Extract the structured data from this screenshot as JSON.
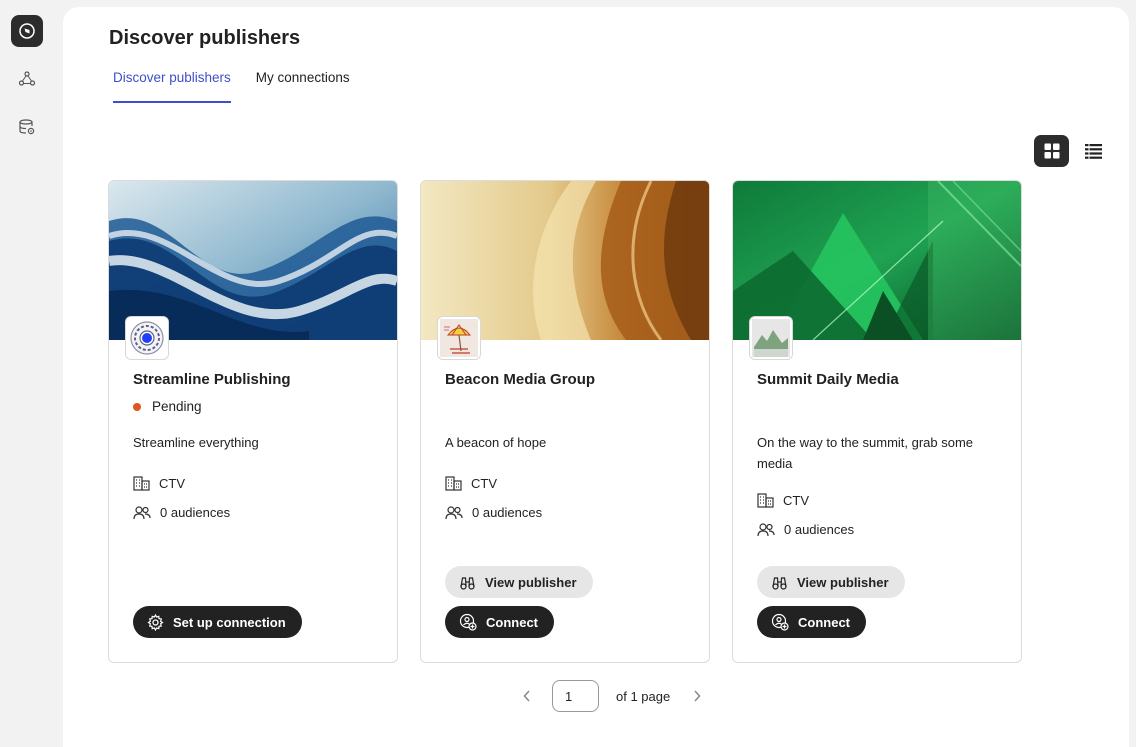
{
  "header": {
    "title": "Discover publishers",
    "tabs": [
      {
        "label": "Discover publishers",
        "selected": true
      },
      {
        "label": "My connections",
        "selected": false
      }
    ]
  },
  "rail": {
    "items": [
      "compass-icon",
      "connections-icon",
      "data-settings-icon"
    ]
  },
  "view_toggle": {
    "active": "grid"
  },
  "cards": [
    {
      "name": "Streamline Publishing",
      "status": "Pending",
      "description": "Streamline everything",
      "type": "CTV",
      "audiences": "0 audiences",
      "primary_button": "Set up connection"
    },
    {
      "name": "Beacon Media Group",
      "description": "A beacon of hope",
      "type": "CTV",
      "audiences": "0 audiences",
      "secondary_button": "View publisher",
      "primary_button": "Connect"
    },
    {
      "name": "Summit Daily Media",
      "description": "On the way to the summit, grab some media",
      "type": "CTV",
      "audiences": "0 audiences",
      "secondary_button": "View publisher",
      "primary_button": "Connect"
    }
  ],
  "pagination": {
    "current_page": "1",
    "total_label": "of 1 page"
  },
  "colors": {
    "accent": "#3d4fcc",
    "status_pending": "#e0561c",
    "button_dark": "#222222"
  }
}
